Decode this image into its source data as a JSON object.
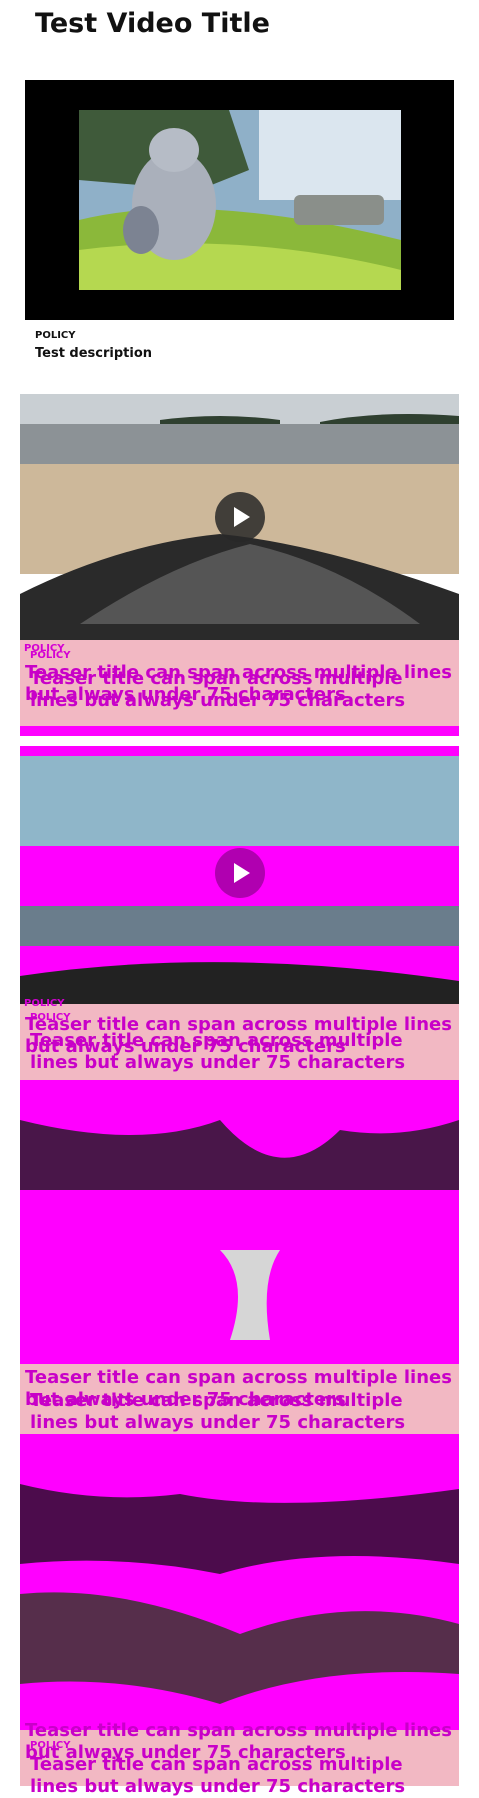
{
  "page": {
    "title": "Test Video Title"
  },
  "player": {
    "category": "POLICY",
    "description": "Test description"
  },
  "teasers": [
    {
      "label_a": "POLICY",
      "label_b": "POLICY",
      "title_a": "Teaser title can span across multiple lines but always under 75 characters",
      "title_b": "Teaser title can span across multiple lines but always under 75 characters"
    },
    {
      "label_a": "POLICY",
      "label_b": "POLICY",
      "title_a": "Teaser title can span across multiple lines but always under 75 characters",
      "title_b": "Teaser title can span across multiple lines but always under 75 characters"
    },
    {
      "title_a": "Teaser title can span across multiple lines but always under 75 characters",
      "title_b": "Teaser title can span across multiple lines but always under 75 characters"
    },
    {
      "label_a": "POLICY",
      "title_a": "Teaser title can span across multiple lines but always under 75 characters",
      "title_b": "Teaser title can span across multiple lines but always under 75 characters"
    }
  ],
  "icons": {
    "play": "play-icon"
  },
  "colors": {
    "accent": "#ff00ff",
    "band": "#f2b8c3"
  }
}
